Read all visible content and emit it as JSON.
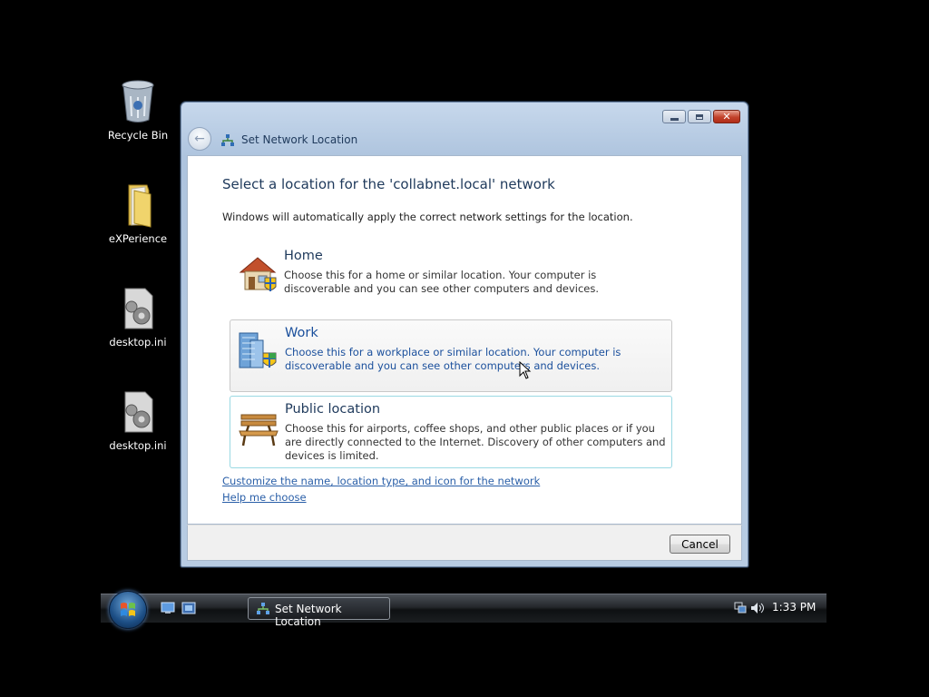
{
  "desktop": {
    "icons": [
      {
        "label": "Recycle Bin",
        "icon": "recycle-bin-icon"
      },
      {
        "label": "eXPerience",
        "icon": "folder-icon"
      },
      {
        "label": "desktop.ini",
        "icon": "settings-file-icon"
      },
      {
        "label": "desktop.ini",
        "icon": "settings-file-icon"
      }
    ]
  },
  "window": {
    "title": "Set Network Location",
    "heading": "Select a location for the 'collabnet.local' network",
    "description": "Windows will automatically apply the correct network settings for the location.",
    "options": [
      {
        "title": "Home",
        "text": "Choose this for a home or similar location. Your computer is discoverable and you can see other computers and devices.",
        "icon": "house-icon"
      },
      {
        "title": "Work",
        "text": "Choose this for a workplace or similar location. Your computer is discoverable and you can see other computers and devices.",
        "icon": "office-building-icon"
      },
      {
        "title": "Public location",
        "text": "Choose this for airports, coffee shops, and other public places or if you are directly connected to the Internet. Discovery of other computers and devices is limited.",
        "icon": "park-bench-icon"
      }
    ],
    "links": {
      "customize": "Customize the name, location type, and icon for the network",
      "help": "Help me choose"
    },
    "cancel_label": "Cancel"
  },
  "taskbar": {
    "task_label": "Set Network Location",
    "clock": "1:33 PM"
  },
  "colors": {
    "heading": "#1e395b",
    "link": "#2a5fa8",
    "hover_text": "#1a4f9c"
  }
}
